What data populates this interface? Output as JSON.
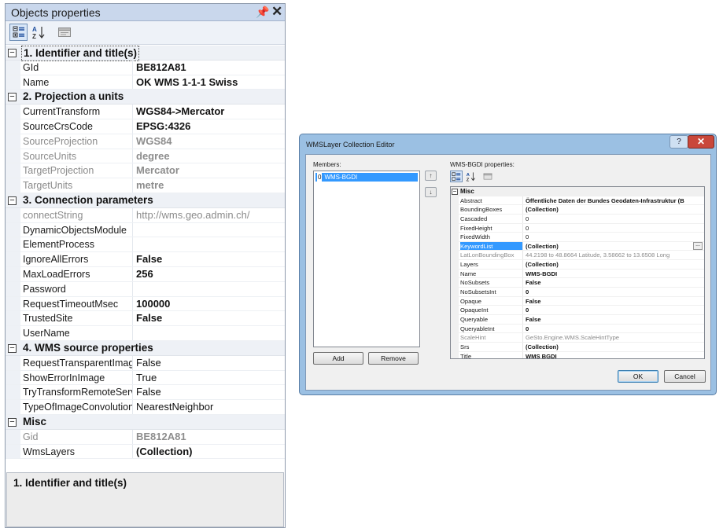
{
  "leftPanel": {
    "title": "Objects properties",
    "pin": "📌",
    "close": "✕",
    "categories": [
      {
        "title": "1. Identifier and title(s)",
        "rows": [
          {
            "name": "GId",
            "value": "BE812A81",
            "bold": true,
            "disabled": false
          },
          {
            "name": "Name",
            "value": "OK WMS 1-1-1 Swiss",
            "bold": true,
            "disabled": false
          }
        ]
      },
      {
        "title": "2. Projection a units",
        "rows": [
          {
            "name": "CurrentTransform",
            "value": "WGS84->Mercator",
            "bold": true,
            "disabled": false
          },
          {
            "name": "SourceCrsCode",
            "value": "EPSG:4326",
            "bold": true,
            "disabled": false
          },
          {
            "name": "SourceProjection",
            "value": "WGS84",
            "bold": true,
            "disabled": true
          },
          {
            "name": "SourceUnits",
            "value": "degree",
            "bold": true,
            "disabled": true
          },
          {
            "name": "TargetProjection",
            "value": "Mercator",
            "bold": true,
            "disabled": true
          },
          {
            "name": "TargetUnits",
            "value": "metre",
            "bold": true,
            "disabled": true
          }
        ]
      },
      {
        "title": "3. Connection parameters",
        "rows": [
          {
            "name": "connectString",
            "value": "http://wms.geo.admin.ch/",
            "bold": false,
            "disabled": true
          },
          {
            "name": "DynamicObjectsModule",
            "value": "",
            "bold": false,
            "disabled": false
          },
          {
            "name": "ElementProcess",
            "value": "",
            "bold": false,
            "disabled": false
          },
          {
            "name": "IgnoreAllErrors",
            "value": "False",
            "bold": true,
            "disabled": false
          },
          {
            "name": "MaxLoadErrors",
            "value": "256",
            "bold": true,
            "disabled": false
          },
          {
            "name": "Password",
            "value": "",
            "bold": false,
            "disabled": false
          },
          {
            "name": "RequestTimeoutMsec",
            "value": "100000",
            "bold": true,
            "disabled": false
          },
          {
            "name": "TrustedSite",
            "value": "False",
            "bold": true,
            "disabled": false
          },
          {
            "name": "UserName",
            "value": "",
            "bold": false,
            "disabled": false
          }
        ]
      },
      {
        "title": "4. WMS source properties",
        "rows": [
          {
            "name": "RequestTransparentImag",
            "value": "False",
            "bold": false,
            "disabled": false
          },
          {
            "name": "ShowErrorInImage",
            "value": "True",
            "bold": false,
            "disabled": false
          },
          {
            "name": "TryTransformRemoteServ",
            "value": "False",
            "bold": false,
            "disabled": false
          },
          {
            "name": "TypeOfImageConvolution",
            "value": "NearestNeighbor",
            "bold": false,
            "disabled": false
          }
        ]
      },
      {
        "title": "Misc",
        "rows": [
          {
            "name": "Gid",
            "value": "BE812A81",
            "bold": true,
            "disabled": true
          },
          {
            "name": "WmsLayers",
            "value": "(Collection)",
            "bold": true,
            "disabled": false
          }
        ]
      }
    ],
    "description": "1. Identifier and title(s)"
  },
  "dialog": {
    "title": "WMSLayer Collection Editor",
    "help": "?",
    "close": "✕",
    "membersLabel": "Members:",
    "memberIndex": "0",
    "memberName": "WMS-BGDI",
    "upArrow": "↑",
    "downArrow": "↓",
    "addLabel": "Add",
    "removeLabel": "Remove",
    "propertiesLabel": "WMS-BGDI properties:",
    "category": "Misc",
    "properties": [
      {
        "name": "Abstract",
        "value": "Öffentliche Daten der Bundes Geodaten-Infrastruktur (B",
        "bold": true,
        "disabled": false
      },
      {
        "name": "BoundingBoxes",
        "value": "(Collection)",
        "bold": true,
        "disabled": false
      },
      {
        "name": "Cascaded",
        "value": "0",
        "bold": false,
        "disabled": false
      },
      {
        "name": "FixedHeight",
        "value": "0",
        "bold": false,
        "disabled": false
      },
      {
        "name": "FixedWidth",
        "value": "0",
        "bold": false,
        "disabled": false
      },
      {
        "name": "KeywordList",
        "value": "(Collection)",
        "bold": true,
        "disabled": false,
        "selected": true
      },
      {
        "name": "LatLonBoundingBox",
        "value": "44.2198 to 48.8664 Latitude, 3.58662 to 13.6508 Long",
        "bold": false,
        "disabled": true
      },
      {
        "name": "Layers",
        "value": "(Collection)",
        "bold": true,
        "disabled": false
      },
      {
        "name": "Name",
        "value": "WMS-BGDI",
        "bold": true,
        "disabled": false
      },
      {
        "name": "NoSubsets",
        "value": "False",
        "bold": true,
        "disabled": false
      },
      {
        "name": "NoSubsetsInt",
        "value": "0",
        "bold": true,
        "disabled": false
      },
      {
        "name": "Opaque",
        "value": "False",
        "bold": true,
        "disabled": false
      },
      {
        "name": "OpaqueInt",
        "value": "0",
        "bold": true,
        "disabled": false
      },
      {
        "name": "Queryable",
        "value": "False",
        "bold": true,
        "disabled": false
      },
      {
        "name": "QueryableInt",
        "value": "0",
        "bold": true,
        "disabled": false
      },
      {
        "name": "ScaleHint",
        "value": "GeSto.Engine.WMS.ScaleHintType",
        "bold": false,
        "disabled": true
      },
      {
        "name": "Srs",
        "value": "(Collection)",
        "bold": true,
        "disabled": false
      },
      {
        "name": "Title",
        "value": "WMS BGDI",
        "bold": true,
        "disabled": false
      }
    ],
    "ellipsis": "...",
    "okLabel": "OK",
    "cancelLabel": "Cancel"
  },
  "colors": {
    "selection": "#3399ff",
    "titleBar": "#c9d7ec",
    "dialogFrame": "#9bc0e3",
    "closeRed": "#c9473a"
  }
}
